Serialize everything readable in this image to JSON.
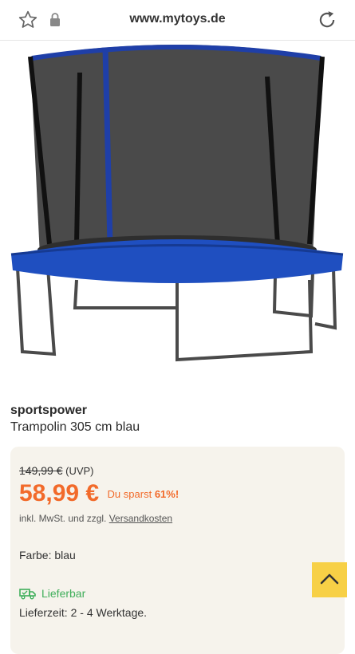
{
  "browser": {
    "url": "www.mytoys.de",
    "icons": [
      "star-icon",
      "lock-icon",
      "reload-icon"
    ]
  },
  "product": {
    "image_alt": "Trampolin",
    "brand": "sportspower",
    "title": "Trampolin 305 cm blau"
  },
  "pricing": {
    "old_price": "149,99 €",
    "uvp_label": "(UVP)",
    "price": "58,99 €",
    "savings_label": "Du sparst",
    "savings_percent": "61%!",
    "tax_text": "inkl. MwSt. und zzgl.",
    "shipping_link": "Versandkosten"
  },
  "details": {
    "color_text": "Farbe: blau",
    "availability": "Lieferbar",
    "delivery_time": "Lieferzeit: 2 - 4 Werktage."
  },
  "colors": {
    "accent": "#f26a2a",
    "available": "#3fae5a",
    "card_bg": "#f6f3ec",
    "scroll_button": "#f7d046"
  }
}
